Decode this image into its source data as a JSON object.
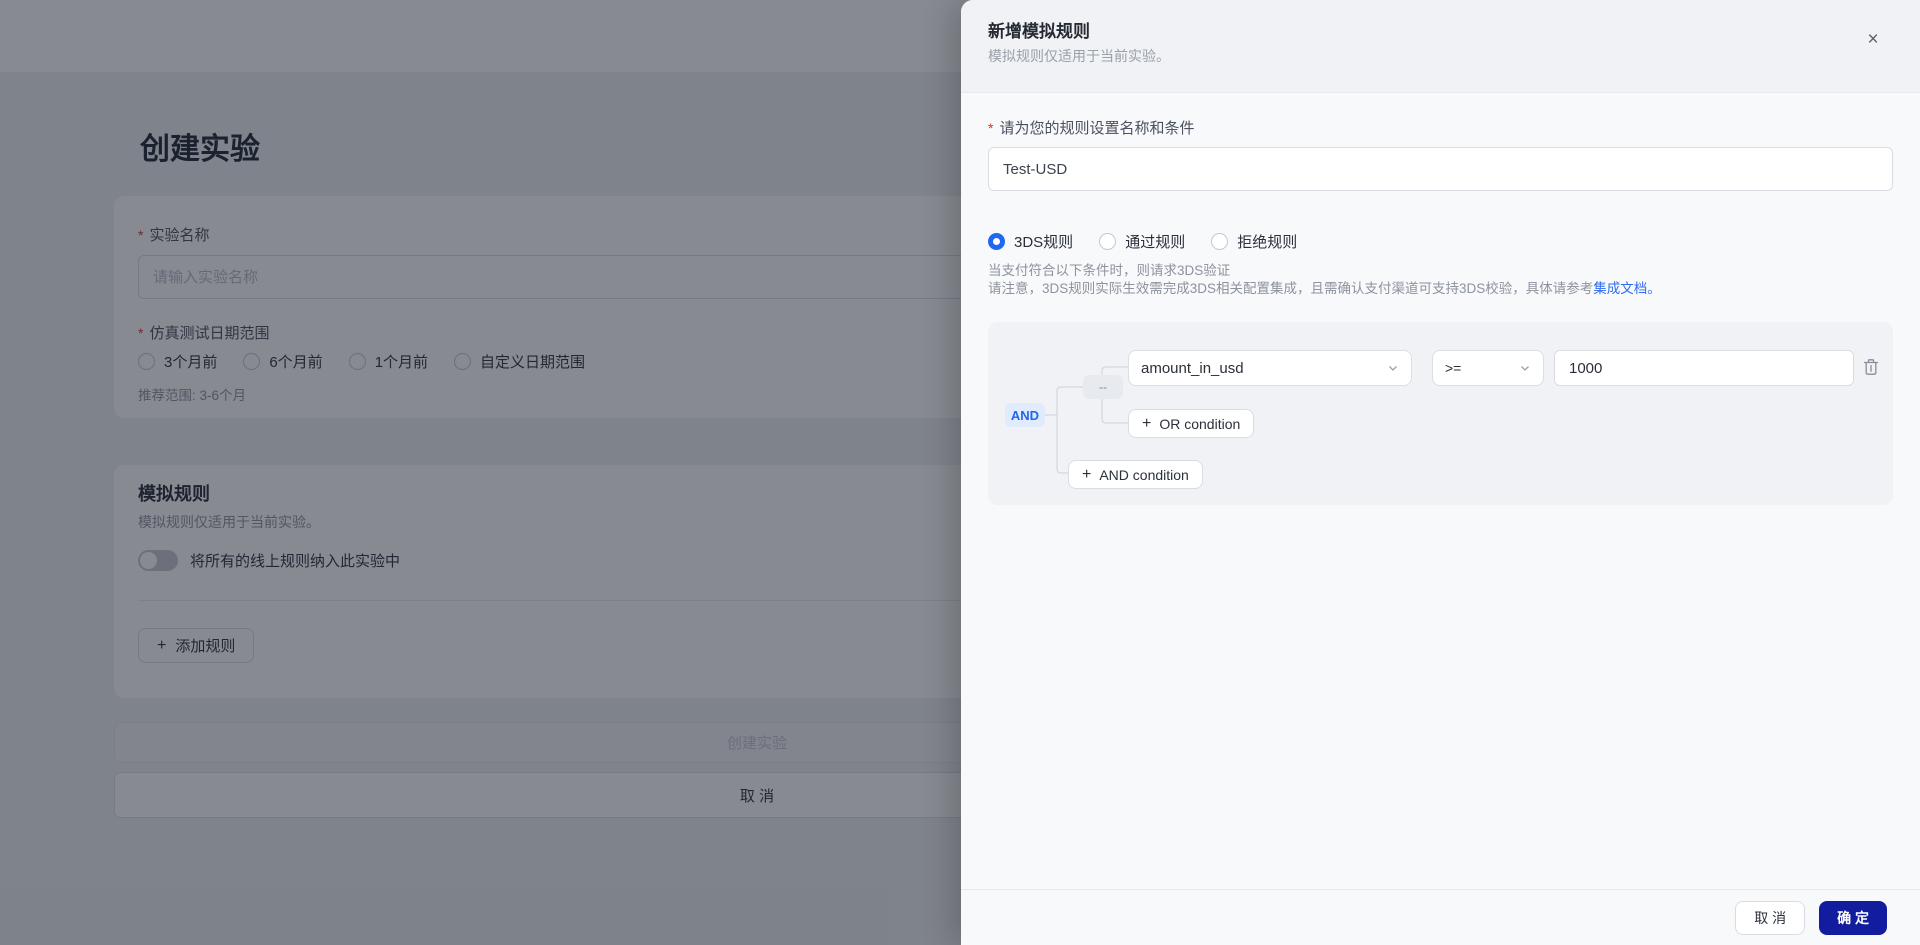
{
  "colors": {
    "primary_blue": "#1f68f0",
    "link_blue": "#2e6cf0",
    "confirm_navy": "#121c9e",
    "required_red": "#c43a3a",
    "and_tag_bg": "#e0ebfd"
  },
  "icons": {
    "close": "×",
    "plus": "+",
    "required_asterisk": "*",
    "chevron_down": "chevron-down",
    "trash": "trash"
  },
  "page": {
    "title": "创建实验",
    "experiment_form": {
      "name_label": "实验名称",
      "name_placeholder": "请输入实验名称",
      "date_range_label": "仿真测试日期范围",
      "date_options": [
        {
          "label": "3个月前",
          "selected": false
        },
        {
          "label": "6个月前",
          "selected": false
        },
        {
          "label": "1个月前",
          "selected": false
        },
        {
          "label": "自定义日期范围",
          "selected": false
        }
      ],
      "date_hint": "推荐范围: 3-6个月"
    },
    "rules_section": {
      "title": "模拟规则",
      "subtitle": "模拟规则仅适用于当前实验。",
      "toggle_label": "将所有的线上规则纳入此实验中",
      "toggle_state": "off",
      "add_rule_label": "添加规则"
    },
    "submit_label": "创建实验",
    "cancel_label": "取 消"
  },
  "drawer": {
    "title": "新增模拟规则",
    "subtitle": "模拟规则仅适用于当前实验。",
    "rule_form": {
      "label": "请为您的规则设置名称和条件",
      "name_value": "Test-USD",
      "rule_types": [
        {
          "label": "3DS规则",
          "selected": true
        },
        {
          "label": "通过规则",
          "selected": false
        },
        {
          "label": "拒绝规则",
          "selected": false
        }
      ],
      "hint_line1": "当支付符合以下条件时，则请求3DS验证",
      "hint_line2": "请注意，3DS规则实际生效需完成3DS相关配置集成，且需确认支付渠道可支持3DS校验，具体请参考",
      "hint_link": "集成文档。"
    },
    "condition_builder": {
      "group_operator": "AND",
      "subgroup_label": "--",
      "condition": {
        "field": "amount_in_usd",
        "operator": ">=",
        "value": "1000"
      },
      "or_button_label": "OR condition",
      "and_button_label": "AND condition"
    },
    "footer": {
      "cancel_label": "取 消",
      "confirm_label": "确 定"
    }
  }
}
